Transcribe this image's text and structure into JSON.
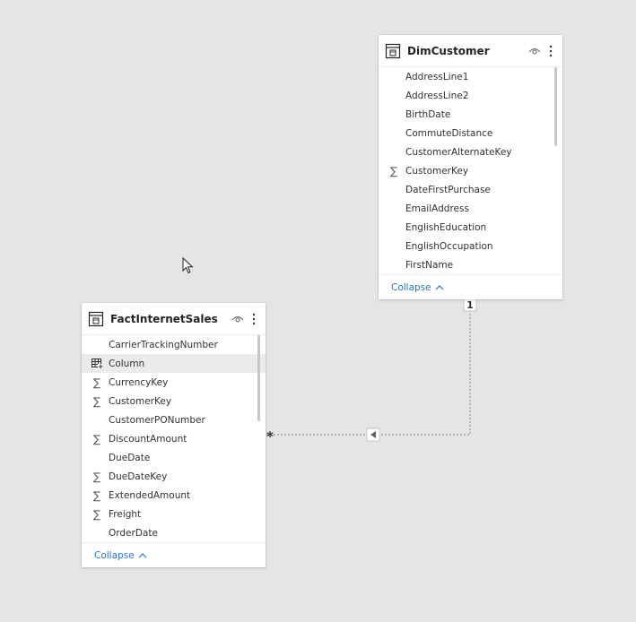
{
  "relationship": {
    "one_marker": "1",
    "many_marker": "*"
  },
  "dim_customer": {
    "title": "DimCustomer",
    "fields": [
      {
        "name": "AddressLine1",
        "icon": ""
      },
      {
        "name": "AddressLine2",
        "icon": ""
      },
      {
        "name": "BirthDate",
        "icon": ""
      },
      {
        "name": "CommuteDistance",
        "icon": ""
      },
      {
        "name": "CustomerAlternateKey",
        "icon": ""
      },
      {
        "name": "CustomerKey",
        "icon": "sigma"
      },
      {
        "name": "DateFirstPurchase",
        "icon": ""
      },
      {
        "name": "EmailAddress",
        "icon": ""
      },
      {
        "name": "EnglishEducation",
        "icon": ""
      },
      {
        "name": "EnglishOccupation",
        "icon": ""
      },
      {
        "name": "FirstName",
        "icon": ""
      }
    ],
    "collapse_label": "Collapse"
  },
  "fact_internet_sales": {
    "title": "FactInternetSales",
    "fields": [
      {
        "name": "CarrierTrackingNumber",
        "icon": ""
      },
      {
        "name": "Column",
        "icon": "calculated-column"
      },
      {
        "name": "CurrencyKey",
        "icon": "sigma"
      },
      {
        "name": "CustomerKey",
        "icon": "sigma"
      },
      {
        "name": "CustomerPONumber",
        "icon": ""
      },
      {
        "name": "DiscountAmount",
        "icon": "sigma"
      },
      {
        "name": "DueDate",
        "icon": ""
      },
      {
        "name": "DueDateKey",
        "icon": "sigma"
      },
      {
        "name": "ExtendedAmount",
        "icon": "sigma"
      },
      {
        "name": "Freight",
        "icon": "sigma"
      },
      {
        "name": "OrderDate",
        "icon": ""
      }
    ],
    "collapse_label": "Collapse"
  },
  "colors": {
    "canvas": "#e6e5e4",
    "link": "#2b72c4",
    "highlight": "#edebe9",
    "connector": "#8a8886"
  }
}
